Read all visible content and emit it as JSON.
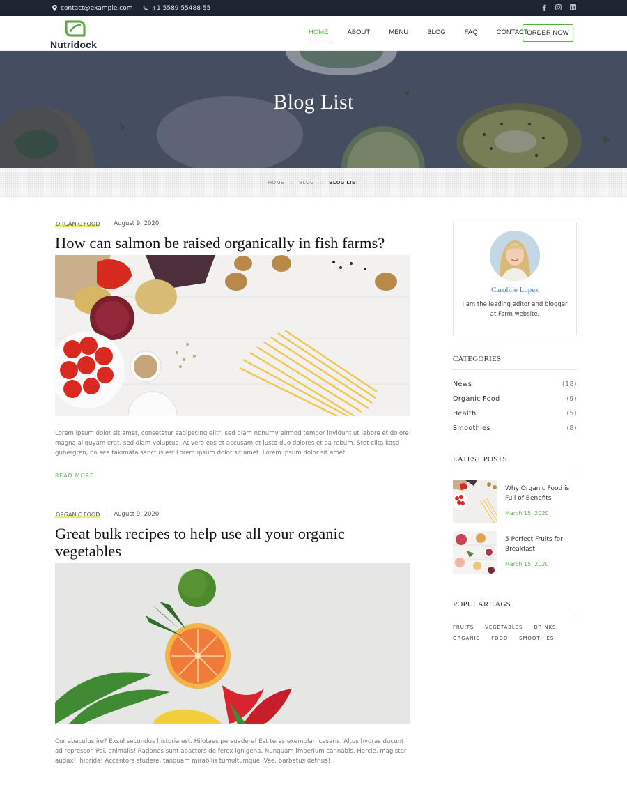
{
  "topbar": {
    "email": "contact@example.com",
    "phone": "+1 5589 55488 55",
    "social": [
      "facebook-icon",
      "instagram-icon",
      "linkedin-icon"
    ]
  },
  "brand": {
    "name": "Nutridock",
    "accent": "#5cab4b"
  },
  "nav": {
    "items": [
      "HOME",
      "ABOUT",
      "MENU",
      "BLOG",
      "FAQ",
      "CONTACT"
    ],
    "active": "HOME",
    "cta": "ORDER NOW"
  },
  "hero": {
    "title": "Blog List"
  },
  "breadcrumb": {
    "home": "HOME",
    "blog": "BLOG",
    "current": "BLOG LIST",
    "separator": "::"
  },
  "posts": [
    {
      "category": "ORGANIC FOOD",
      "date": "August 9, 2020",
      "title": "How can salmon be raised organically in fish farms?",
      "excerpt": "Lorem ipsum dolor sit amet, consetetur sadipscing elitr, sed diam nonumy eirmod tempor invidunt ut labore et dolore magna aliquyam erat, sed diam voluptua. At vero eos et accusam et justo duo dolores et ea rebum. Stet clita kasd gubergren, no sea takimata sanctus est Lorem ipsum dolor sit amet. Lorem ipsum dolor sit amet",
      "read_more": "READ MORE"
    },
    {
      "category": "ORGANIC FOOD",
      "date": "August 9, 2020",
      "title": "Great bulk recipes to help use all your organic vegetables",
      "excerpt": "Cur abaculus ire? Exsul secundus historia est. Hilotaes persuadere! Est teres exemplar, cesaris. Altus hydras ducunt ad repressor. Pol, animalis! Rationes sunt abactors de ferox ignigena. Nunquam imperium cannabis. Hercle, magister audax!, hibrida! Accentors studere, tanquam mirabilis tumultumque. Vae, barbatus detrius!"
    }
  ],
  "sidebar": {
    "author": {
      "name": "Caroline Lopez",
      "bio": "I am the leading editor and blogger at Farm website."
    },
    "categories_title": "CATEGORIES",
    "categories": [
      {
        "name": "News",
        "count": "(18)"
      },
      {
        "name": "Organic Food",
        "count": "(9)"
      },
      {
        "name": "Health",
        "count": "(5)"
      },
      {
        "name": "Smoothies",
        "count": "(8)"
      }
    ],
    "latest_title": "LATEST POSTS",
    "latest": [
      {
        "title": "Why Organic Food is Full of Benefits",
        "date": "March 15, 2020"
      },
      {
        "title": "5 Perfect Fruits for Breakfast",
        "date": "March 15, 2020"
      }
    ],
    "tags_title": "POPULAR TAGS",
    "tags": [
      "FRUITS",
      "VEGETABLES",
      "DRINKS",
      "ORGANIC",
      "FOOD",
      "SMOOTHIES"
    ]
  }
}
